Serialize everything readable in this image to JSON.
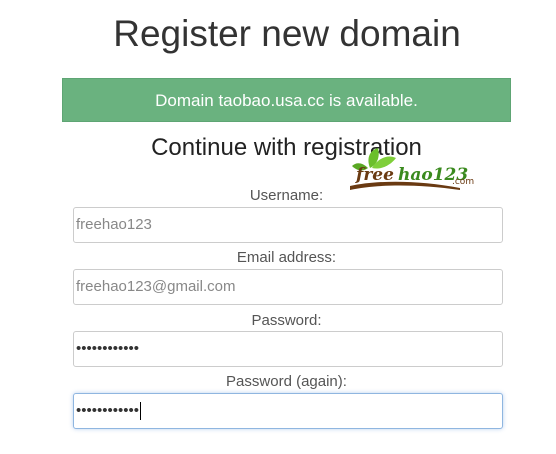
{
  "page": {
    "title": "Register new domain",
    "alert_text": "Domain taobao.usa.cc is available.",
    "subtitle": "Continue with registration"
  },
  "logo": {
    "text_main": "freehao123",
    "text_suffix": ".com",
    "leaf_color": "#6bbf2c",
    "text_color": "#6a3a12"
  },
  "form": {
    "username_label": "Username:",
    "username_value": "freehao123",
    "email_label": "Email address:",
    "email_value": "freehao123@gmail.com",
    "password_label": "Password:",
    "password_mask": "••••••••••••",
    "password_again_label": "Password (again):",
    "password_again_mask": "••••••••••••"
  },
  "colors": {
    "alert_bg": "#6ab27f",
    "focus_border": "#8fb6e0"
  }
}
